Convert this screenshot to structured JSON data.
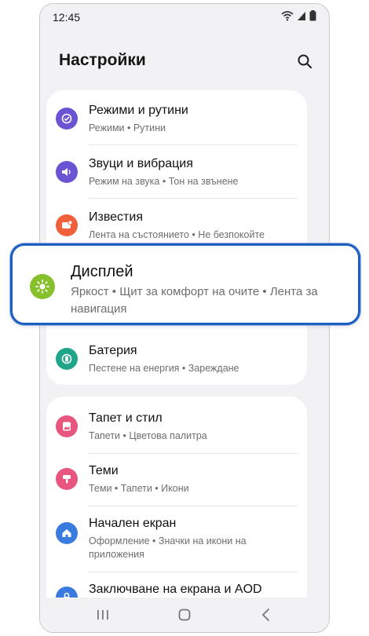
{
  "status": {
    "time": "12:45"
  },
  "header": {
    "title": "Настройки"
  },
  "items": [
    {
      "title": "Режими и рутини",
      "sub": "Режими • Рутини",
      "icon": "modes-routines-icon",
      "color": "#6b54d4"
    },
    {
      "title": "Звуци и вибрация",
      "sub": "Режим на звука • Тон на звънене",
      "icon": "sound-icon",
      "color": "#6b54d4"
    },
    {
      "title": "Известия",
      "sub": "Лента на състоянието • Не безпокойте",
      "icon": "notifications-icon",
      "color": "#f0603a"
    },
    {
      "title": "Батерия",
      "sub": "Пестене на енергия • Зареждане",
      "icon": "battery-icon",
      "color": "#1fa58a"
    },
    {
      "title": "Тапет и стил",
      "sub": "Тапети • Цветова палитра",
      "icon": "wallpaper-icon",
      "color": "#e8557e"
    },
    {
      "title": "Теми",
      "sub": "Теми • Тапети • Икони",
      "icon": "themes-icon",
      "color": "#e8557e"
    },
    {
      "title": "Начален екран",
      "sub": "Оформление • Значки на икони на приложения",
      "icon": "home-icon",
      "color": "#3a7be0"
    },
    {
      "title": "Заключване на екрана и AOD",
      "sub": "",
      "icon": "lock-icon",
      "color": "#3a7be0"
    }
  ],
  "highlight": {
    "title": "Дисплей",
    "sub": "Яркост  •  Щит за комфорт на очите  •  Лента за навигация",
    "icon": "display-icon",
    "color": "#86c12b"
  }
}
